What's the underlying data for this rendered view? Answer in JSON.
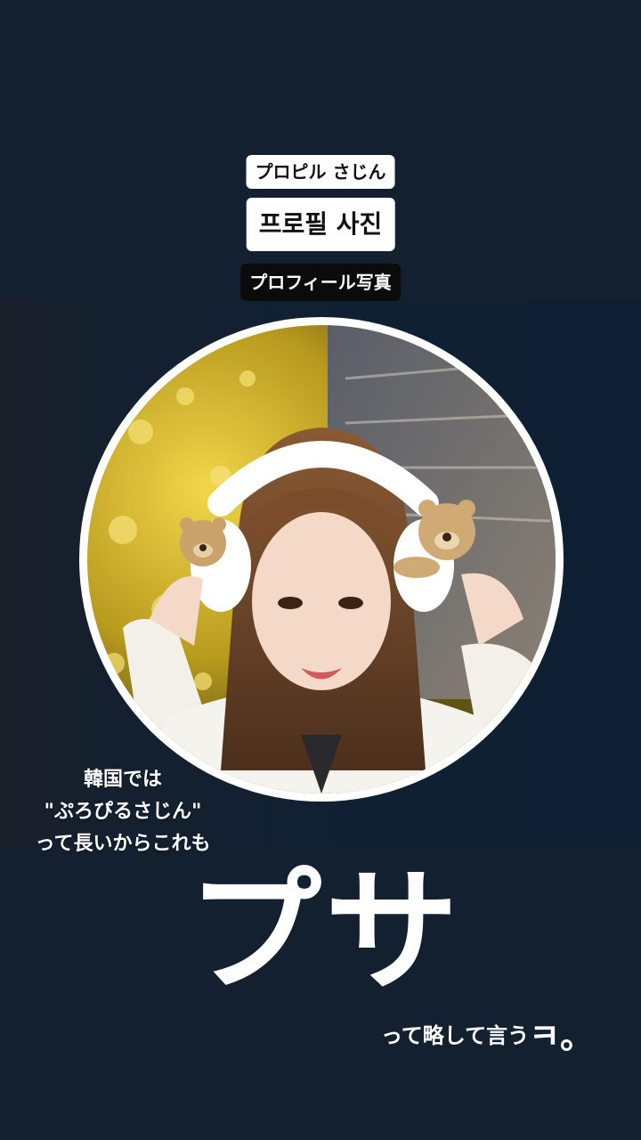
{
  "labels": {
    "katakana_reading": "プロピル さじん",
    "korean_word": "프로필 사진",
    "japanese_word": "プロフィール写真"
  },
  "photo": {
    "subject": "profile-photo"
  },
  "caption": {
    "line1": "韓国では",
    "line2": "\"ぷろぴるさじん\"",
    "line3": "って長いからこれも"
  },
  "abbreviation": "プサ",
  "tail": {
    "text": "って略して言う",
    "emphasis": "ㅋ。"
  },
  "colors": {
    "background": "#13202f",
    "chip_light": "#ffffff",
    "chip_dark": "#0b0b0b"
  }
}
